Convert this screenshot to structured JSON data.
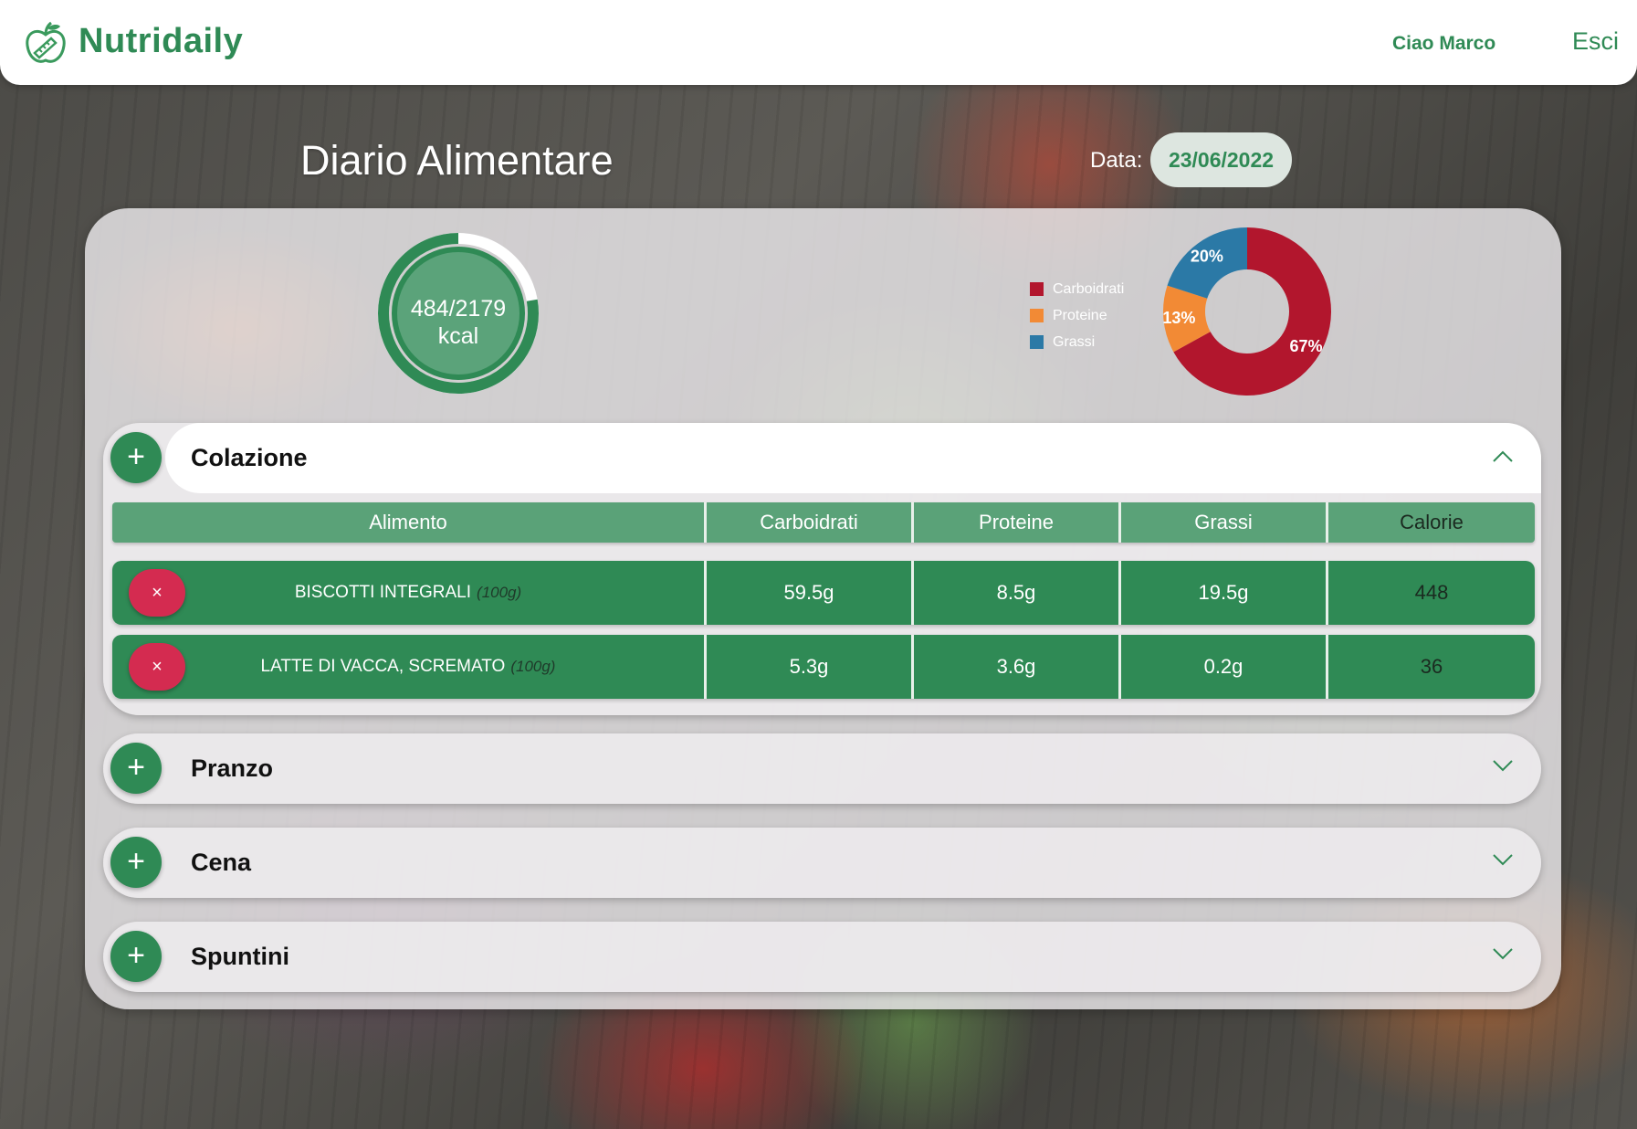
{
  "header": {
    "brand": "Nutridaily",
    "greeting": "Ciao Marco",
    "logout": "Esci"
  },
  "page": {
    "title": "Diario Alimentare",
    "date_label": "Data:",
    "date_value": "23/06/2022"
  },
  "calories": {
    "summary": "484/2179",
    "unit": "kcal",
    "consumed": 484,
    "goal": 2179,
    "ring_color": "#2f8a55"
  },
  "chart_data": {
    "type": "pie",
    "donut": true,
    "categories": [
      "Carboidrati",
      "Proteine",
      "Grassi"
    ],
    "values": [
      67,
      13,
      20
    ],
    "value_labels": [
      "67%",
      "13%",
      "20%"
    ],
    "colors": [
      "#b2162d",
      "#f28a35",
      "#2b79a6"
    ],
    "legend_position": "left"
  },
  "meals": {
    "colazione": {
      "title": "Colazione",
      "expanded": true,
      "columns": [
        "Alimento",
        "Carboidrati",
        "Proteine",
        "Grassi",
        "Calorie"
      ],
      "rows": [
        {
          "name": "BISCOTTI INTEGRALI",
          "qty": "(100g)",
          "carbs": "59.5g",
          "protein": "8.5g",
          "fat": "19.5g",
          "kcal": "448",
          "delete": "×"
        },
        {
          "name": "LATTE DI VACCA, SCREMATO",
          "qty": "(100g)",
          "carbs": "5.3g",
          "protein": "3.6g",
          "fat": "0.2g",
          "kcal": "36",
          "delete": "×"
        }
      ]
    },
    "pranzo": {
      "title": "Pranzo",
      "expanded": false
    },
    "cena": {
      "title": "Cena",
      "expanded": false
    },
    "spuntini": {
      "title": "Spuntini",
      "expanded": false
    },
    "add_symbol": "+"
  },
  "colors": {
    "brand_green": "#2f8a55",
    "header_green": "#5aa278",
    "delete_red": "#d42b50"
  }
}
